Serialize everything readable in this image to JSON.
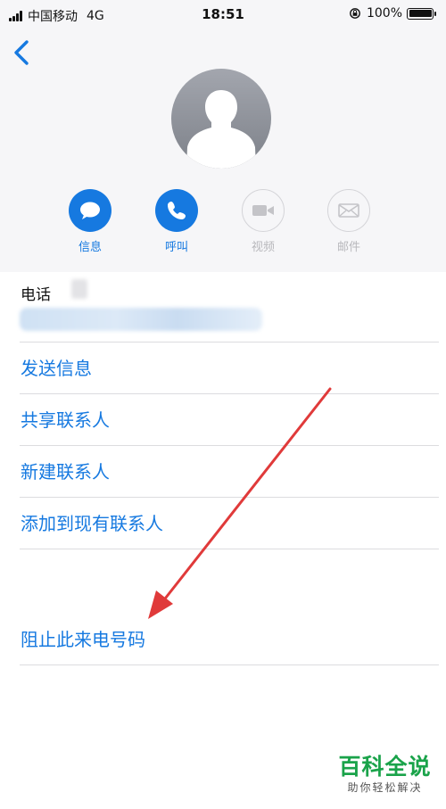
{
  "status_bar": {
    "carrier": "中国移动",
    "network": "4G",
    "time": "18:51",
    "battery_percent": "100%",
    "battery_level": 1.0
  },
  "nav": {
    "back_icon": "chevron-left-icon"
  },
  "avatar": {
    "icon": "person-silhouette-icon"
  },
  "actions": [
    {
      "label": "信息",
      "icon": "message-bubble-icon",
      "enabled": true
    },
    {
      "label": "呼叫",
      "icon": "phone-icon",
      "enabled": true
    },
    {
      "label": "视频",
      "icon": "video-camera-icon",
      "enabled": false
    },
    {
      "label": "邮件",
      "icon": "envelope-icon",
      "enabled": false
    }
  ],
  "phone_section": {
    "label": "电话"
  },
  "menu": {
    "send_message": "发送信息",
    "share_contact": "共享联系人",
    "create_contact": "新建联系人",
    "add_to_existing": "添加到现有联系人",
    "block_caller": "阻止此来电号码"
  },
  "watermark": {
    "title": "百科全说",
    "subtitle": "助你轻松解决"
  },
  "colors": {
    "accent": "#1679e0",
    "disabled": "#b8b8bc",
    "header_background": "#f6f6f8",
    "annotation_arrow": "#e03a3a",
    "watermark_green": "#1aa34a"
  }
}
